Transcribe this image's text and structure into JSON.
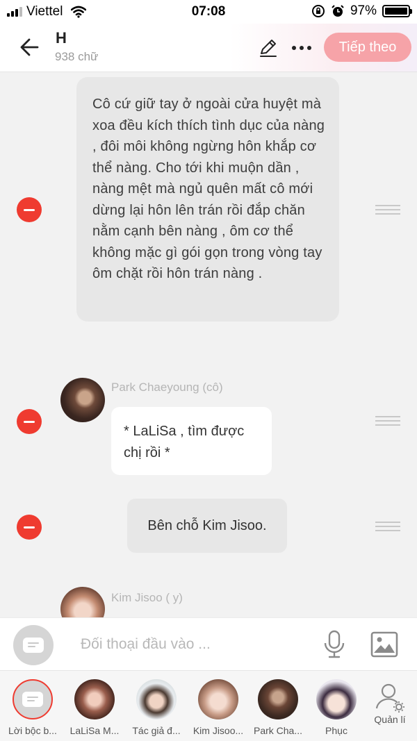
{
  "status_bar": {
    "carrier": "Viettel",
    "time": "07:08",
    "battery": "97%"
  },
  "header": {
    "title": "H",
    "word_count": "938 chữ",
    "next_label": "Tiếp theo"
  },
  "messages": [
    {
      "type": "narration",
      "text": "Cô cứ giữ tay ở ngoài cửa huyệt mà xoa đều kích thích tình dục của nàng , đôi môi không ngừng hôn khắp cơ thể nàng. Cho tới khi muộn dần , nàng mệt mà ngủ quên mất cô mới dừng lại hôn lên trán rồi đắp chăn nằm cạnh bên nàng , ôm cơ thể không mặc gì gói gọn trong vòng tay ôm chặt rồi hôn trán nàng ."
    },
    {
      "type": "character",
      "sender": "Park Chaeyoung (cô)",
      "text": "* LaLiSa , tìm được chị rồi *"
    },
    {
      "type": "narration",
      "text": "Bên chỗ Kim Jisoo."
    },
    {
      "type": "character",
      "sender": "Kim Jisoo ( y)",
      "text": ""
    }
  ],
  "input": {
    "placeholder": "Đối thoại đầu vào ..."
  },
  "characters": [
    {
      "label": "Lời bộc b..."
    },
    {
      "label": "LaLiSa M..."
    },
    {
      "label": "Tác giả đ..."
    },
    {
      "label": "Kim Jisoo..."
    },
    {
      "label": "Park Cha..."
    },
    {
      "label": "Phục"
    },
    {
      "label": "Quản lí"
    }
  ],
  "colors": {
    "accent": "#f6a3a8",
    "delete": "#ef3b30",
    "narration_bubble": "#e7e7e7"
  }
}
